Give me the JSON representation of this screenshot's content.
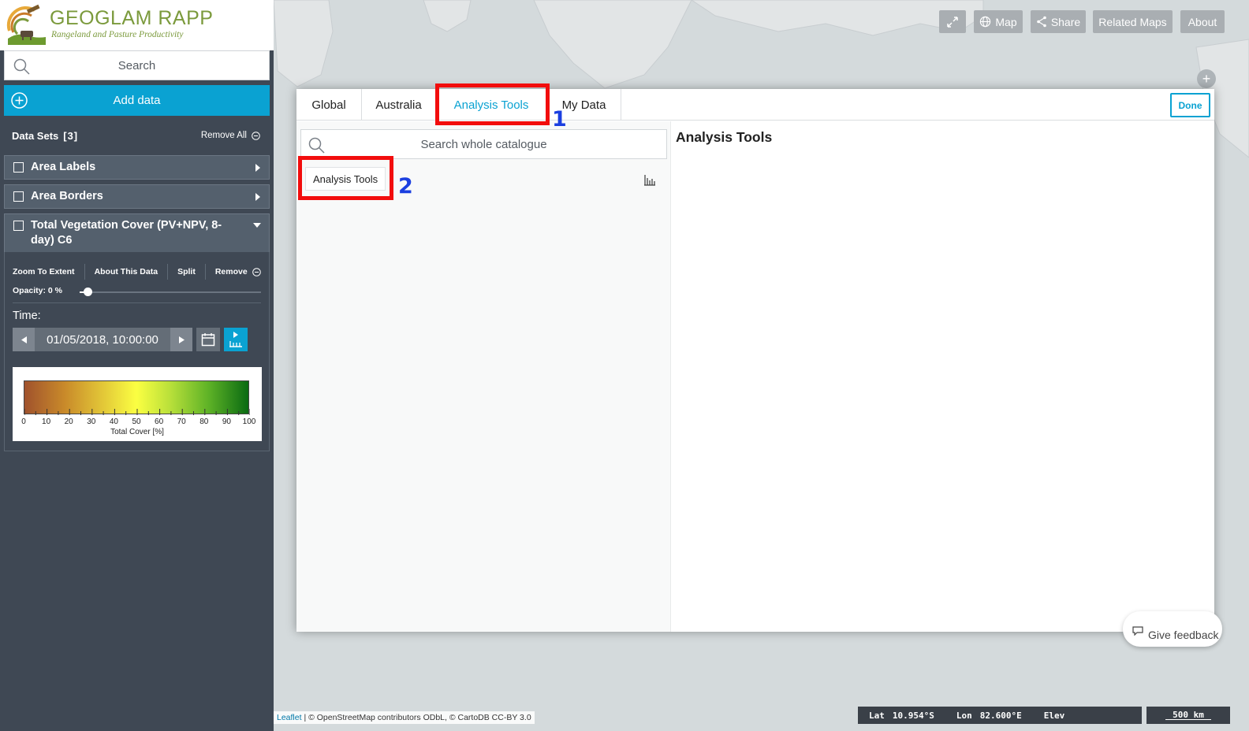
{
  "brand": {
    "title": "GEOGLAM RAPP",
    "subtitle": "Rangeland and Pasture Productivity"
  },
  "map_toolbar": {
    "fullscreen_icon": "expand-icon",
    "map_label": "Map",
    "share_label": "Share",
    "related_maps_label": "Related Maps",
    "about_label": "About",
    "zoom_in_label": "+"
  },
  "sidebar": {
    "search_placeholder": "Search",
    "add_data_label": "Add data",
    "datasets_label": "Data Sets",
    "datasets_count": "[3]",
    "remove_all_label": "Remove All",
    "items": [
      {
        "label": "Area Labels",
        "checked": false,
        "expanded": false
      },
      {
        "label": "Area Borders",
        "checked": false,
        "expanded": false
      },
      {
        "label": "Total Vegetation Cover (PV+NPV, 8-day) C6",
        "checked": false,
        "expanded": true
      }
    ],
    "expanded_item": {
      "zoom_to_extent": "Zoom To Extent",
      "about_this_data": "About This Data",
      "split": "Split",
      "remove": "Remove",
      "opacity_label": "Opacity: 0 %",
      "opacity_value": 0,
      "time_label": "Time:",
      "time_value": "01/05/2018, 10:00:00",
      "legend": {
        "ticks": [
          "0",
          "10",
          "20",
          "30",
          "40",
          "50",
          "60",
          "70",
          "80",
          "90",
          "100"
        ],
        "caption": "Total Cover [%]",
        "colors": [
          "#a0522d",
          "#e7d23a",
          "#fbff42",
          "#5fb327",
          "#0a6a12"
        ]
      }
    }
  },
  "modal": {
    "tabs": [
      {
        "label": "Global",
        "active": false
      },
      {
        "label": "Australia",
        "active": false
      },
      {
        "label": "Analysis Tools",
        "active": true
      },
      {
        "label": "My Data",
        "active": false
      }
    ],
    "done_label": "Done",
    "catalogue_search_placeholder": "Search whole catalogue",
    "catalogue_item_label": "Analysis Tools",
    "catalogue_item_icon": "chart-icon",
    "detail_title": "Analysis Tools"
  },
  "annotations": {
    "first": "1",
    "second": "2",
    "color": "#f20d0d",
    "number_color": "#1b3fe0"
  },
  "feedback_label": "Give feedback",
  "attribution": {
    "leaflet": "Leaflet",
    "rest": " | © OpenStreetMap contributors ODbL, © CartoDB CC-BY 3.0"
  },
  "status": {
    "lat_label": "Lat",
    "lat_value": "10.954°S",
    "lon_label": "Lon",
    "lon_value": "82.600°E",
    "elev_label": "Elev",
    "scale_label": "500 km"
  },
  "colors": {
    "accent": "#0aa2d2",
    "sidebar_bg": "#3f4854",
    "brand_green": "#7b9a3c"
  }
}
